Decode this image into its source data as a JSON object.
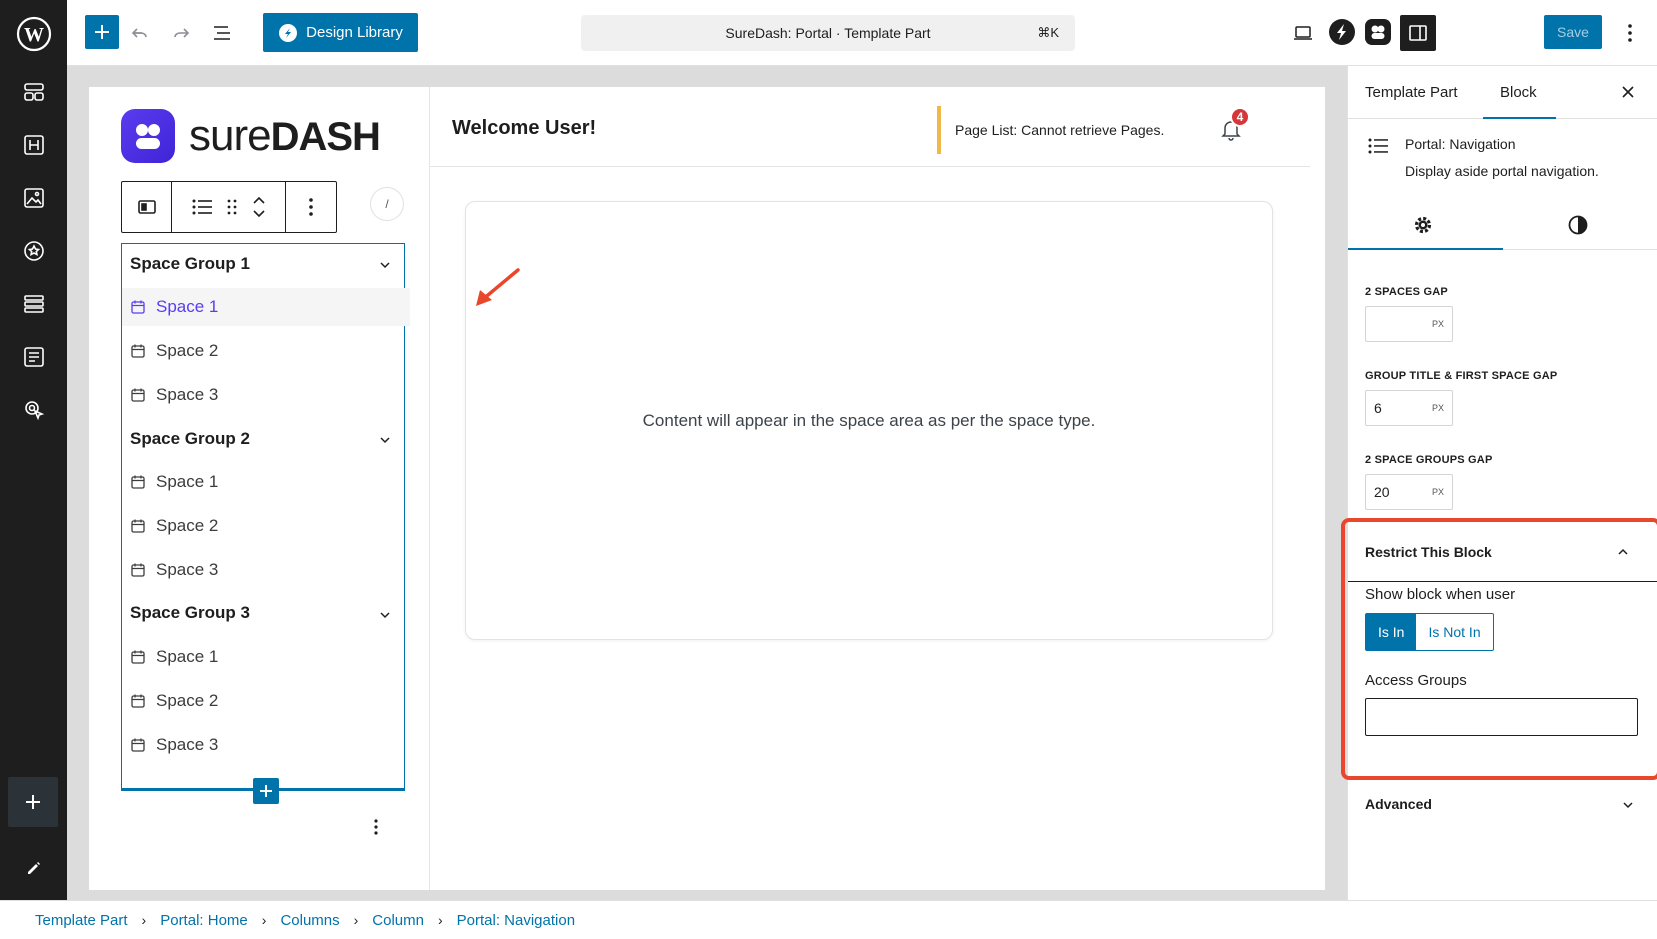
{
  "toolbar": {
    "design_library": "Design Library",
    "doc_title": "SureDash: Portal · Template Part",
    "shortcut": "⌘K",
    "save": "Save"
  },
  "brand": {
    "name_light": "sure",
    "name_bold": "DASH"
  },
  "portal": {
    "welcome": "Welcome User!",
    "notice": "Page List: Cannot retrieve Pages.",
    "notification_count": "4",
    "content_placeholder": "Content will appear in the space area as per the space type.",
    "slash": "/"
  },
  "navigation": {
    "groups": [
      {
        "title": "Space Group 1",
        "spaces": [
          "Space 1",
          "Space 2",
          "Space 3"
        ]
      },
      {
        "title": "Space Group 2",
        "spaces": [
          "Space 1",
          "Space 2",
          "Space 3"
        ]
      },
      {
        "title": "Space Group 3",
        "spaces": [
          "Space 1",
          "Space 2",
          "Space 3"
        ]
      }
    ]
  },
  "settings": {
    "tabs": [
      "Template Part",
      "Block"
    ],
    "block_name": "Portal: Navigation",
    "block_desc": "Display aside portal navigation.",
    "spaces_gap_label": "2 SPACES GAP",
    "spaces_gap_value": "",
    "title_gap_label": "GROUP TITLE & FIRST SPACE GAP",
    "title_gap_value": "6",
    "groups_gap_label": "2 SPACE GROUPS GAP",
    "groups_gap_value": "20",
    "unit": "PX",
    "restrict_title": "Restrict This Block",
    "show_when": "Show block when user",
    "is_in": "Is In",
    "is_not_in": "Is Not In",
    "access_groups": "Access Groups",
    "advanced": "Advanced"
  },
  "breadcrumb": [
    "Template Part",
    "Portal: Home",
    "Columns",
    "Column",
    "Portal: Navigation"
  ],
  "colors": {
    "accent": "#0073aa",
    "highlight": "#e9472b",
    "brand": "#5b3cf0"
  }
}
